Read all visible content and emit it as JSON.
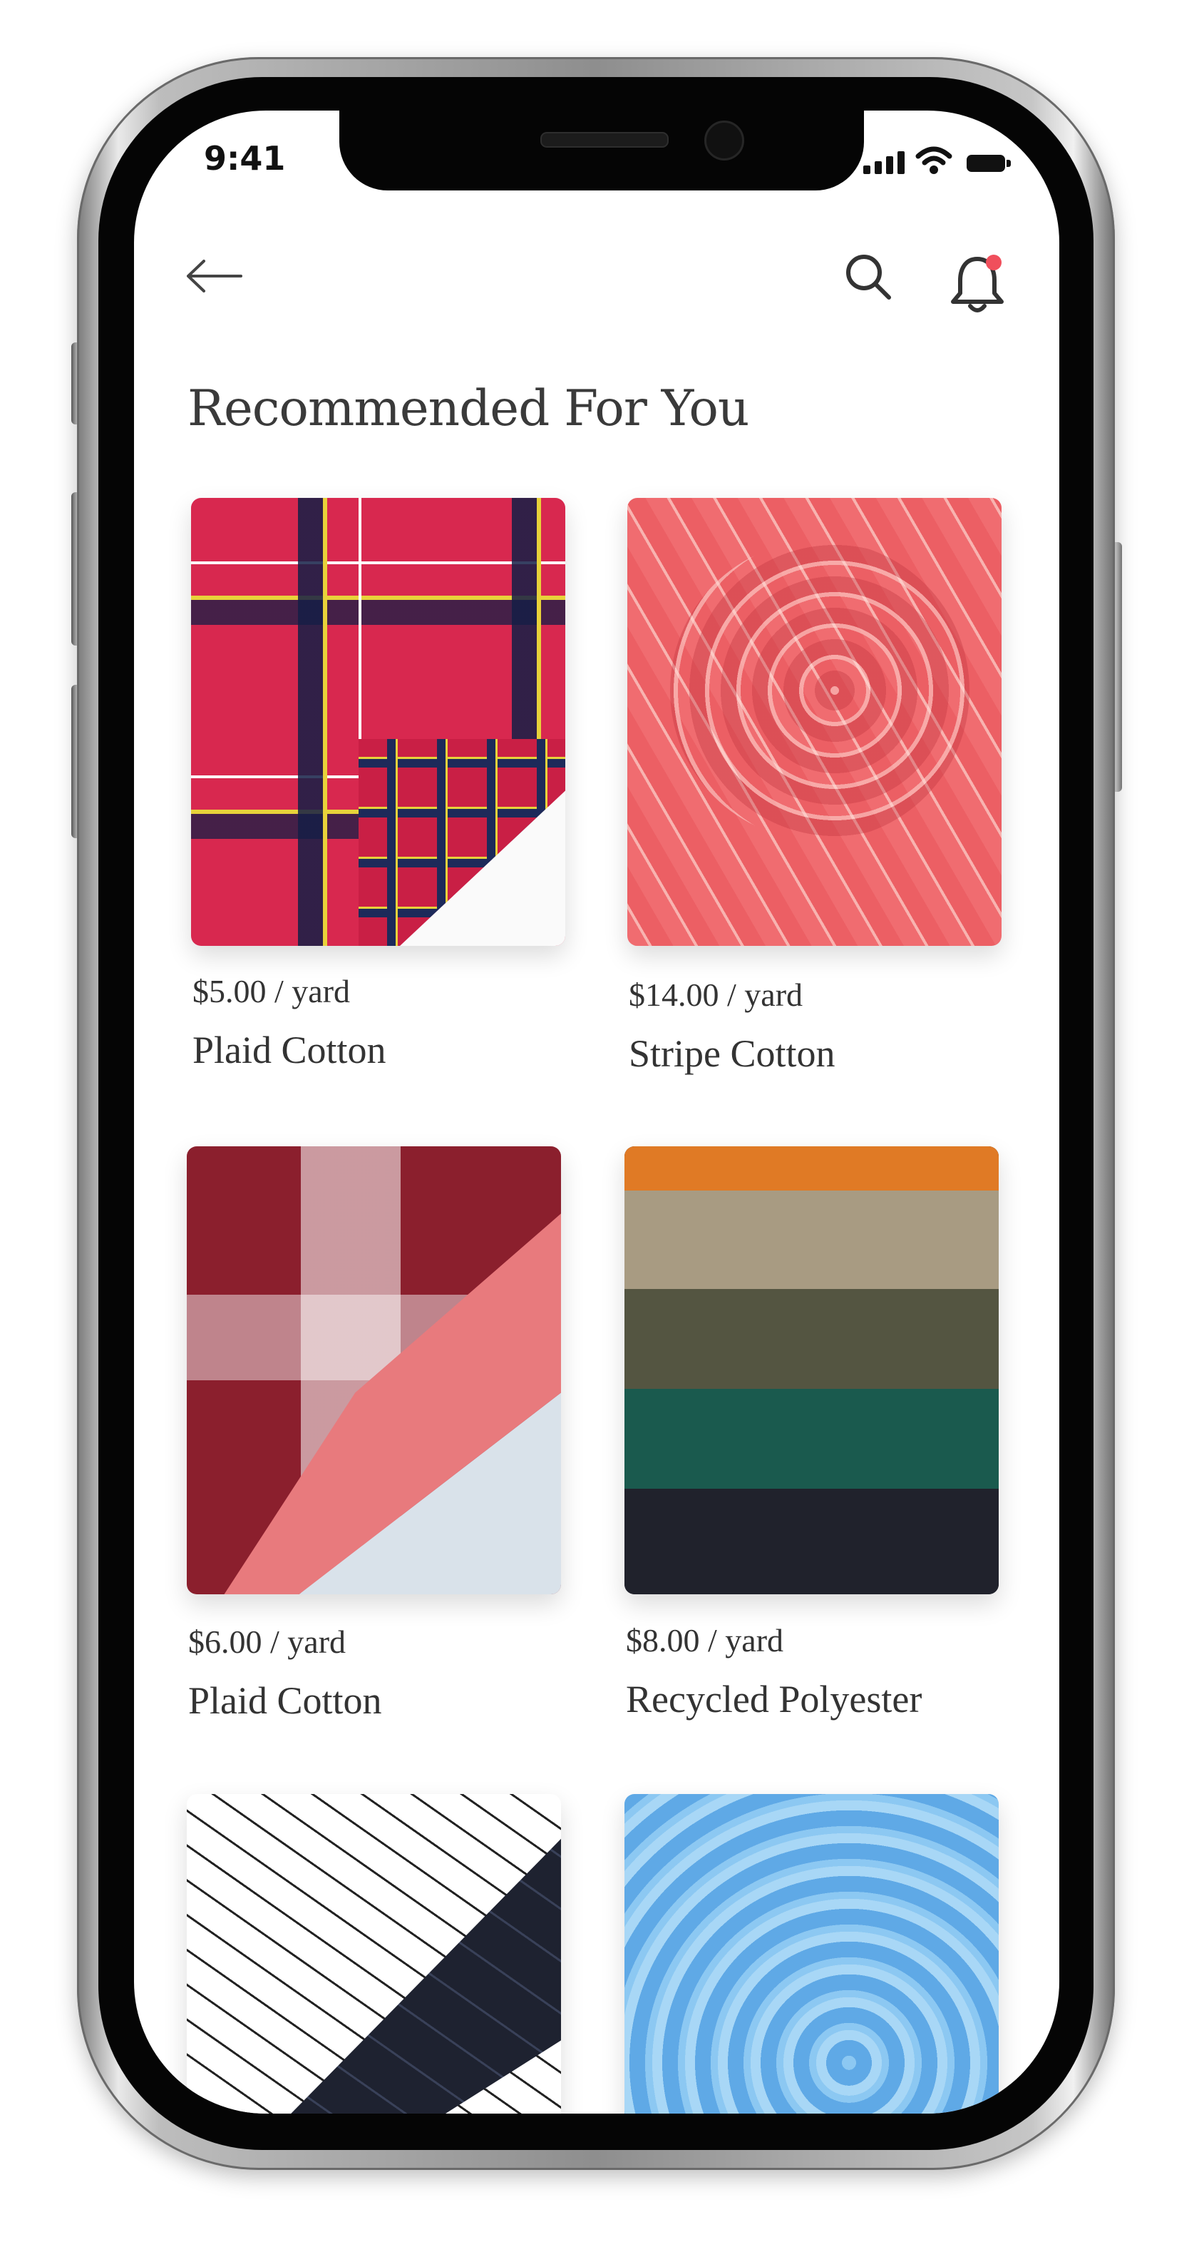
{
  "status_bar": {
    "time": "9:41"
  },
  "header": {
    "back_icon": "arrow-left-icon",
    "search_icon": "search-icon",
    "notification_icon": "bell-icon",
    "notification_dot_color": "#f04f5c"
  },
  "page": {
    "title": "Recommended For You"
  },
  "products": [
    {
      "price": "$5.00 / yard",
      "name": "Plaid Cotton",
      "swatch": "red plaid"
    },
    {
      "price": "$14.00 / yard",
      "name": "Stripe Cotton",
      "swatch": "coral stripe"
    },
    {
      "price": "$6.00 / yard",
      "name": "Plaid Cotton",
      "swatch": "burgundy check"
    },
    {
      "price": "$8.00 / yard",
      "name": "Recycled Polyester",
      "swatch": "color stack"
    },
    {
      "price": "",
      "name": "",
      "swatch": "leaf print"
    },
    {
      "price": "",
      "name": "",
      "swatch": "sky blue knit"
    }
  ],
  "colors": {
    "title_text": "#3a3a3a",
    "body_text": "#333333",
    "accent_dot": "#f04f5c"
  }
}
